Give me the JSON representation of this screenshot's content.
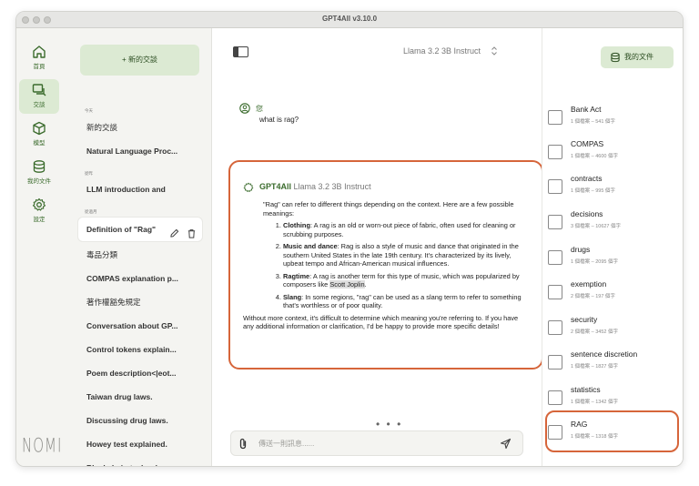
{
  "window": {
    "title": "GPT4All v3.10.0"
  },
  "nav": [
    {
      "label": "首頁",
      "icon": "home-icon"
    },
    {
      "label": "交談",
      "icon": "chat-icon"
    },
    {
      "label": "模型",
      "icon": "cube-icon"
    },
    {
      "label": "我的文件",
      "icon": "database-icon"
    },
    {
      "label": "設定",
      "icon": "gear-icon"
    }
  ],
  "brand_logo": "NOMIC",
  "conversations": {
    "new_chat_label": "+ 新的交談",
    "sections": [
      "今天",
      "從昨",
      "從過月"
    ],
    "items": [
      "新的交談",
      "Natural Language Proc...",
      "LLM introduction and",
      "Definition of \"Rag\"",
      "毒品分類",
      "COMPAS explanation p...",
      "著作權豁免規定",
      "Conversation about GP...",
      "Control tokens explain...",
      "Poem description<|eot...",
      "Taiwan drug laws.",
      "Discussing drug laws.",
      "Howey test explained.",
      "Blockchain technology"
    ]
  },
  "header": {
    "model": "Llama 3.2 3B Instruct"
  },
  "messages": {
    "user_name": "您",
    "user_text": "what is rag?",
    "assistant_brand": "GPT4All",
    "assistant_model": "Llama 3.2 3B Instruct",
    "intro": "\"Rag\" can refer to different things depending on the context. Here are a few possible meanings:",
    "points": [
      {
        "term": "Clothing",
        "text": ": A rag is an old or worn-out piece of fabric, often used for cleaning or scrubbing purposes."
      },
      {
        "term": "Music and dance",
        "text": ": Rag is also a style of music and dance that originated in the southern United States in the late 19th century. It's characterized by its lively, upbeat tempo and African-American musical influences."
      },
      {
        "term": "Ragtime",
        "text": ": A rag is another term for this type of music, which was popularized by composers like ",
        "highlight": "Scott Joplin",
        "tail": "."
      },
      {
        "term": "Slang",
        "text": ": In some regions, \"rag\" can be used as a slang term to refer to something that's worthless or of poor quality."
      }
    ],
    "outro": "Without more context, it's difficult to determine which meaning you're referring to. If you have any additional information or clarification, I'd be happy to provide more specific details!"
  },
  "input": {
    "placeholder": "傳送一則訊息......",
    "typing_indicator": "• • •"
  },
  "docs": {
    "button_label": "我的文件",
    "items": [
      {
        "name": "Bank Act",
        "meta": "1 個檔案 – 541 個字"
      },
      {
        "name": "COMPAS",
        "meta": "1 個檔案 – 4600 個字"
      },
      {
        "name": "contracts",
        "meta": "1 個檔案 – 995 個字"
      },
      {
        "name": "decisions",
        "meta": "3 個檔案 – 10627 個字"
      },
      {
        "name": "drugs",
        "meta": "1 個檔案 – 2095 個字"
      },
      {
        "name": "exemption",
        "meta": "2 個檔案 – 197 個字"
      },
      {
        "name": "security",
        "meta": "2 個檔案 – 3452 個字"
      },
      {
        "name": "sentence discretion",
        "meta": "1 個檔案 – 1827 個字"
      },
      {
        "name": "statistics",
        "meta": "1 個檔案 – 1342 個字"
      },
      {
        "name": "RAG",
        "meta": "1 個檔案 – 1318 個字"
      }
    ]
  },
  "colors": {
    "accent": "#dcead3",
    "accent_text": "#3a6b2c",
    "highlight_outline": "#d6653a"
  }
}
